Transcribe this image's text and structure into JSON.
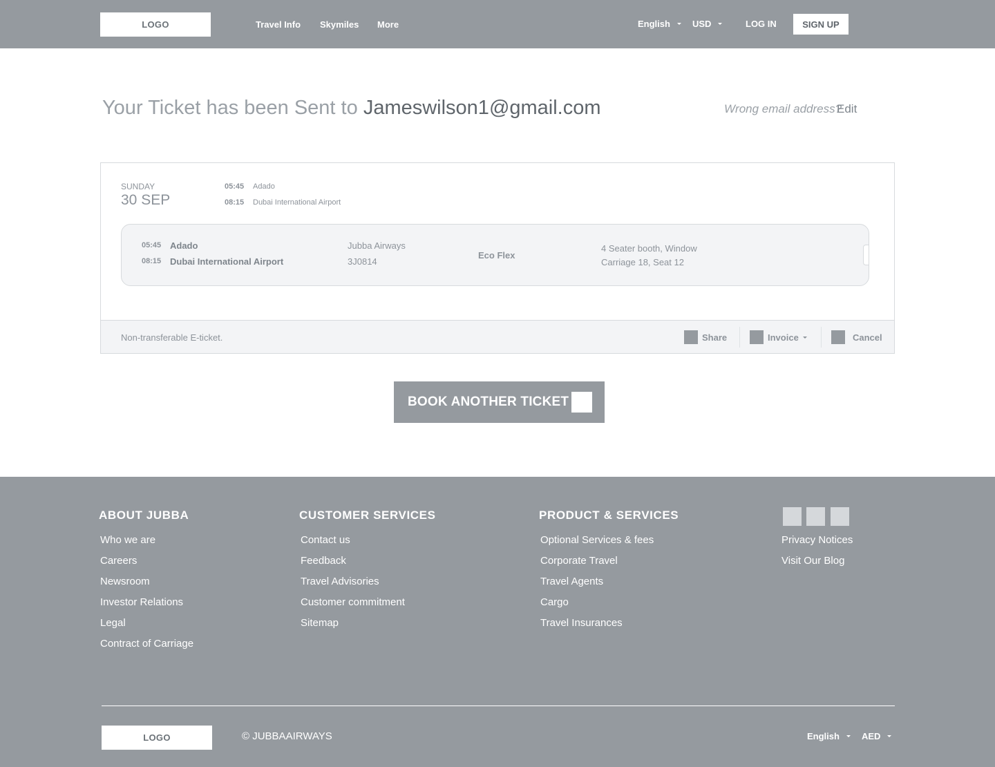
{
  "header": {
    "logo": "LOGO",
    "nav": [
      "Travel Info",
      "Skymiles",
      "More"
    ],
    "language": "English",
    "currency": "USD",
    "login": "LOG IN",
    "signup": "SIGN UP"
  },
  "confirmation": {
    "prefix": "Your Ticket has been Sent to",
    "email": "Jameswilson1@gmail.com",
    "wrong_email": "Wrong email address?",
    "edit": "Edit"
  },
  "ticket": {
    "day": "SUNDAY",
    "date": "30 SEP",
    "summary": [
      {
        "time": "05:45",
        "place": "Adado"
      },
      {
        "time": "08:15",
        "place": "Dubai International Airport"
      }
    ],
    "leg": {
      "departure_time": "05:45",
      "departure_place": "Adado",
      "arrival_time": "08:15",
      "arrival_place": "Dubai International Airport",
      "airline": "Jubba Airways",
      "flight_number": "3J0814",
      "fare": "Eco Flex",
      "seat_line1": "4 Seater booth, Window",
      "seat_line2": "Carriage 18, Seat 12"
    },
    "note": "Non-transferable E-ticket.",
    "actions": {
      "share": "Share",
      "invoice": "Invoice",
      "cancel": "Cancel"
    }
  },
  "book_button": "BOOK ANOTHER TICKET",
  "footer": {
    "about": {
      "title": "ABOUT JUBBA",
      "links": [
        "Who we are",
        "Careers",
        "Newsroom",
        "Investor Relations",
        "Legal",
        "Contract of Carriage"
      ]
    },
    "customer": {
      "title": "CUSTOMER SERVICES",
      "links": [
        "Contact us",
        "Feedback",
        "Travel Advisories",
        "Customer commitment",
        "Sitemap"
      ]
    },
    "products": {
      "title": "PRODUCT & SERVICES",
      "links": [
        "Optional Services & fees",
        "Corporate Travel",
        "Travel Agents",
        "Cargo",
        "Travel Insurances"
      ]
    },
    "extra_links": [
      "Privacy Notices",
      "Visit Our Blog"
    ],
    "logo": "LOGO",
    "copyright": "© JUBBAAIRWAYS",
    "language": "English",
    "currency": "AED"
  },
  "colors": {
    "header_bg": "#959a9f",
    "footer_bg": "#959a9f",
    "card_bg": "#f3f4f6",
    "accent_text": "#5f656b"
  }
}
